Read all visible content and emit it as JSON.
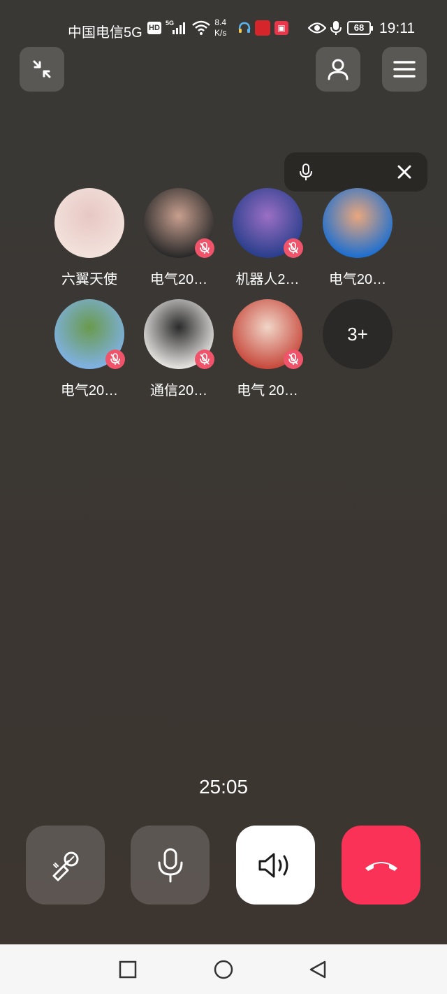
{
  "status_bar": {
    "carrier": "中国电信5G",
    "hd": "HD",
    "network_small": "5G",
    "speed_value": "8.4",
    "speed_unit": "K/s",
    "app3_icon_text": "▣",
    "battery": "68",
    "time": "19:11"
  },
  "participants": [
    {
      "name": "六翼天使",
      "muted": false,
      "avatar_colors": [
        "#f3e2dc",
        "#e7c7c3"
      ]
    },
    {
      "name": "电气20…",
      "muted": true,
      "avatar_colors": [
        "#2a2a2a",
        "#c89f8f"
      ]
    },
    {
      "name": "机器人2…",
      "muted": true,
      "avatar_colors": [
        "#2a3f8c",
        "#9b6fc4"
      ]
    },
    {
      "name": "电气20…",
      "muted": false,
      "avatar_colors": [
        "#1e6fcf",
        "#e9a77d"
      ]
    },
    {
      "name": "电气20…",
      "muted": true,
      "avatar_colors": [
        "#7fb1e4",
        "#6a9a4c"
      ]
    },
    {
      "name": "通信20…",
      "muted": true,
      "avatar_colors": [
        "#e5e3e0",
        "#2b2b2b"
      ]
    },
    {
      "name": "电气 20…",
      "muted": true,
      "avatar_colors": [
        "#c74a3d",
        "#f0d6c8"
      ]
    }
  ],
  "more_count": "3+",
  "timer": "25:05",
  "colors": {
    "hangup": "#fb3257",
    "mute_badge": "#f0546a",
    "background": "#3a3835"
  }
}
